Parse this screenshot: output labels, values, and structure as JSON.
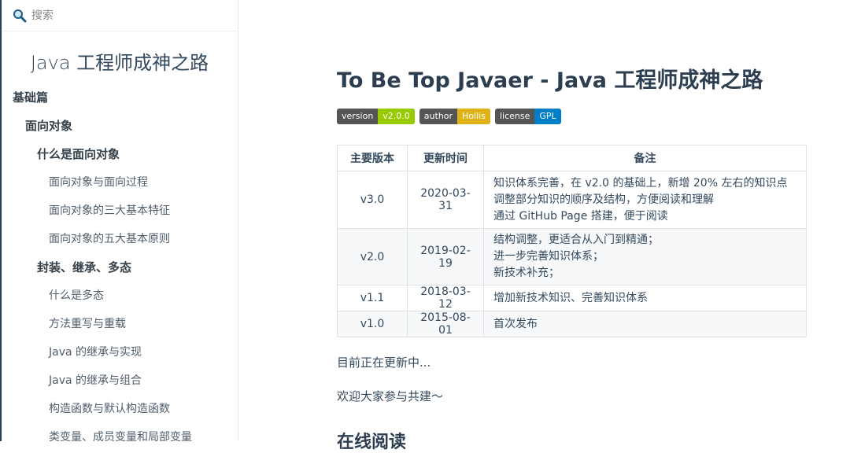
{
  "search": {
    "placeholder": "搜索"
  },
  "sidebar": {
    "app_name": "Java 工程师成神之路",
    "items": [
      {
        "label": "基础篇",
        "level": 1
      },
      {
        "label": "面向对象",
        "level": 2
      },
      {
        "label": "什么是面向对象",
        "level": 3
      },
      {
        "label": "面向对象与面向过程",
        "level": 4
      },
      {
        "label": "面向对象的三大基本特征",
        "level": 4
      },
      {
        "label": "面向对象的五大基本原则",
        "level": 4
      },
      {
        "label": "封装、继承、多态",
        "level": 3
      },
      {
        "label": "什么是多态",
        "level": 4
      },
      {
        "label": "方法重写与重载",
        "level": 4
      },
      {
        "label": "Java 的继承与实现",
        "level": 4
      },
      {
        "label": "Java 的继承与组合",
        "level": 4
      },
      {
        "label": "构造函数与默认构造函数",
        "level": 4
      },
      {
        "label": "类变量、成员变量和局部变量",
        "level": 4
      }
    ]
  },
  "main": {
    "title": "To Be Top Javaer - Java 工程师成神之路",
    "badges": [
      {
        "key": "version",
        "value": "v2.0.0",
        "color": "#97ca00"
      },
      {
        "key": "author",
        "value": "Hollis",
        "color": "#dfb317"
      },
      {
        "key": "license",
        "value": "GPL",
        "color": "#007ec6"
      }
    ],
    "table": {
      "headers": [
        "主要版本",
        "更新时间",
        "备注"
      ],
      "rows": [
        {
          "version": "v3.0",
          "date": "2020-03-31",
          "notes": [
            "知识体系完善，在 v2.0 的基础上，新增 20% 左右的知识点",
            "调整部分知识的顺序及结构，方便阅读和理解",
            "通过 GitHub Page 搭建，便于阅读"
          ]
        },
        {
          "version": "v2.0",
          "date": "2019-02-19",
          "notes": [
            "结构调整，更适合从入门到精通；",
            "进一步完善知识体系；",
            "新技术补充；"
          ]
        },
        {
          "version": "v1.1",
          "date": "2018-03-12",
          "notes": [
            "增加新技术知识、完善知识体系"
          ]
        },
        {
          "version": "v1.0",
          "date": "2015-08-01",
          "notes": [
            "首次发布"
          ]
        }
      ]
    },
    "paragraphs": [
      "目前正在更新中...",
      "欢迎大家参与共建～"
    ],
    "next_heading": "在线阅读"
  }
}
